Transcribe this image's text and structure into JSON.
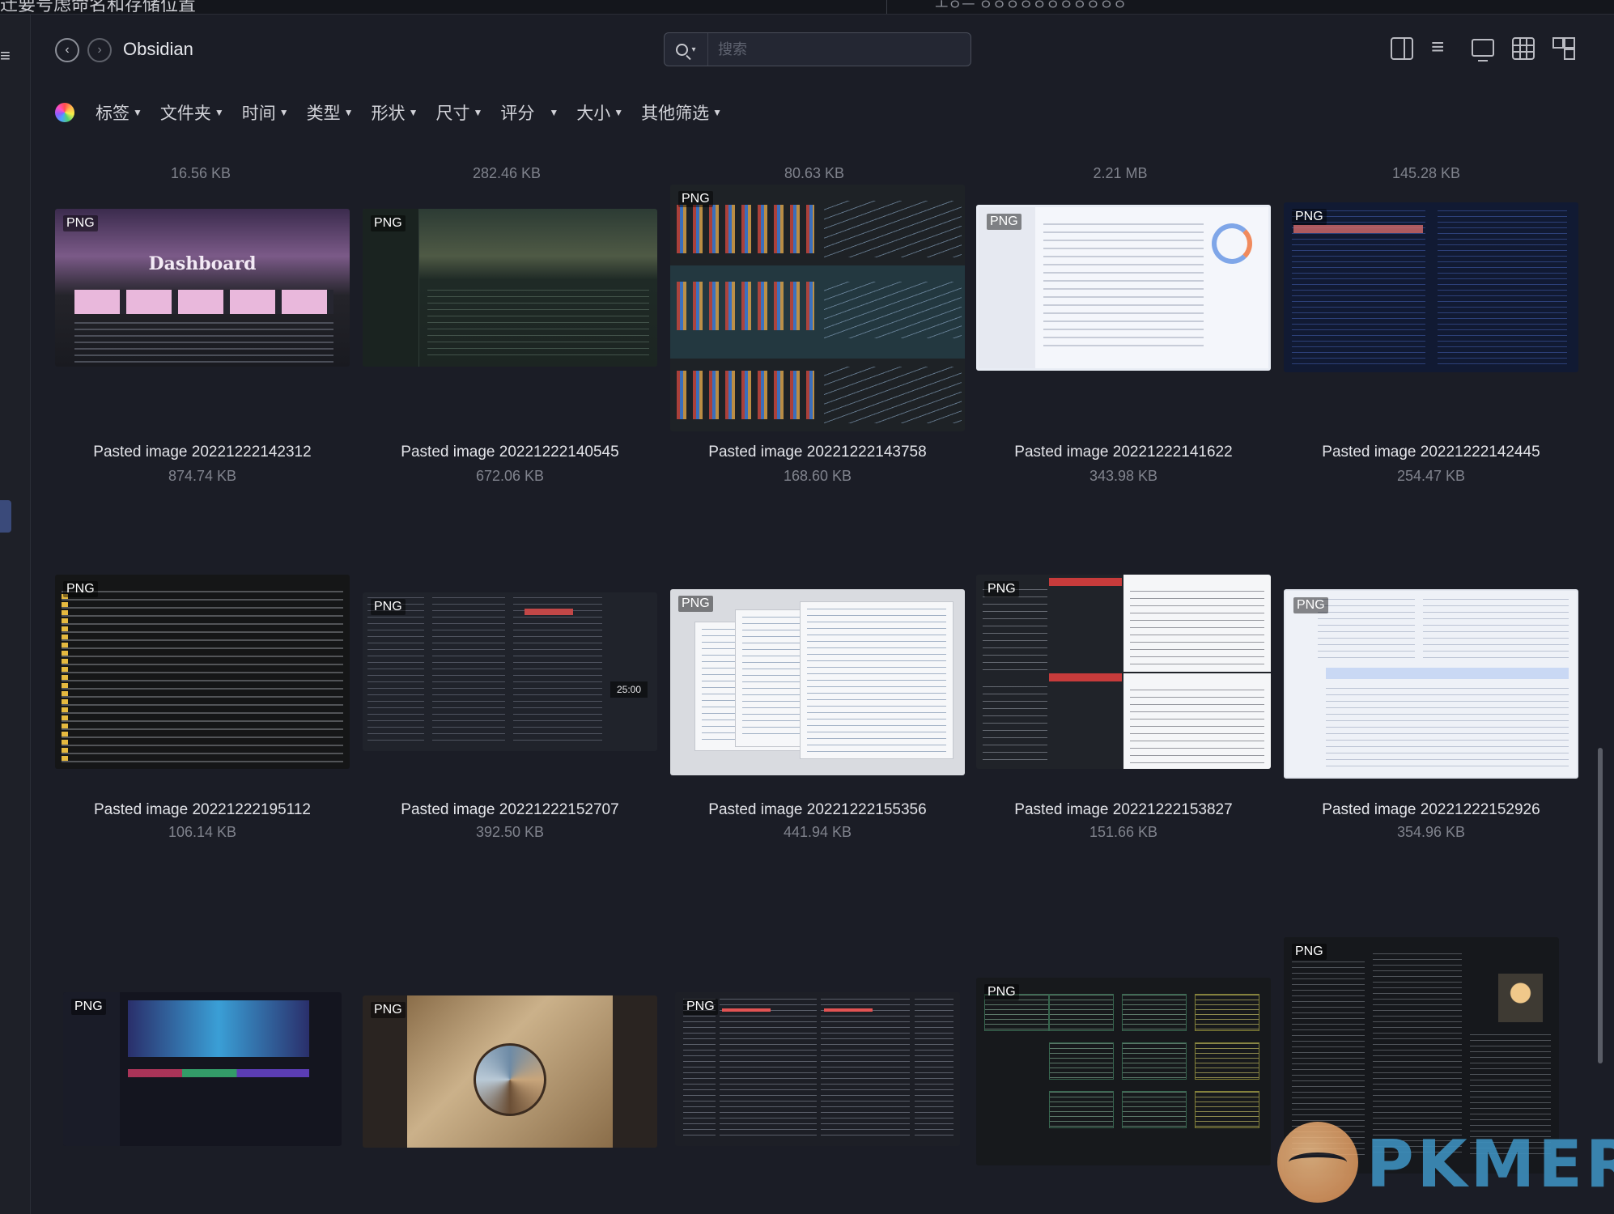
{
  "window": {
    "cut_title": "迁要号虑命名和存储位置",
    "cut_right": "ㅗㅇㅡ ㅇㅇㅇㅇㅇㅇㅇㅇㅇㅇㅇ"
  },
  "header": {
    "back_icon": "chevron-left-icon",
    "forward_icon": "chevron-right-icon",
    "title": "Obsidian"
  },
  "search": {
    "placeholder": "搜索",
    "value": ""
  },
  "toolbar": {
    "icons": [
      "sidebar-panel-icon",
      "sort-icon",
      "monitor-icon",
      "grid-view-icon",
      "layout-icon"
    ]
  },
  "filters": {
    "color_icon": "color-wheel-icon",
    "items": [
      {
        "label": "标签"
      },
      {
        "label": "文件夹"
      },
      {
        "label": "时间"
      },
      {
        "label": "类型"
      },
      {
        "label": "形状"
      },
      {
        "label": "尺寸"
      },
      {
        "label": "评分"
      },
      {
        "label": "大小"
      },
      {
        "label": "其他筛选"
      }
    ]
  },
  "gallery": {
    "top_sizes": [
      "16.56 KB",
      "282.46 KB",
      "80.63 KB",
      "2.21 MB",
      "145.28 KB"
    ],
    "cards": [
      {
        "type": "PNG",
        "name": "Pasted image 20221222142312",
        "size": "874.74 KB",
        "thumb_text": "Dashboard"
      },
      {
        "type": "PNG",
        "name": "Pasted image 20221222140545",
        "size": "672.06 KB"
      },
      {
        "type": "PNG",
        "name": "Pasted image 20221222143758",
        "size": "168.60 KB"
      },
      {
        "type": "PNG",
        "name": "Pasted image 20221222141622",
        "size": "343.98 KB"
      },
      {
        "type": "PNG",
        "name": "Pasted image 20221222142445",
        "size": "254.47 KB"
      },
      {
        "type": "PNG",
        "name": "Pasted image 20221222195112",
        "size": "106.14 KB"
      },
      {
        "type": "PNG",
        "name": "Pasted image 20221222152707",
        "size": "392.50 KB",
        "thumb_text": "25:00"
      },
      {
        "type": "PNG",
        "name": "Pasted image 20221222155356",
        "size": "441.94 KB"
      },
      {
        "type": "PNG",
        "name": "Pasted image 20221222153827",
        "size": "151.66 KB"
      },
      {
        "type": "PNG",
        "name": "Pasted image 20221222152926",
        "size": "354.96 KB"
      },
      {
        "type": "PNG"
      },
      {
        "type": "PNG"
      },
      {
        "type": "PNG"
      },
      {
        "type": "PNG"
      },
      {
        "type": "PNG"
      }
    ]
  },
  "watermark": {
    "text": "PKMER"
  }
}
